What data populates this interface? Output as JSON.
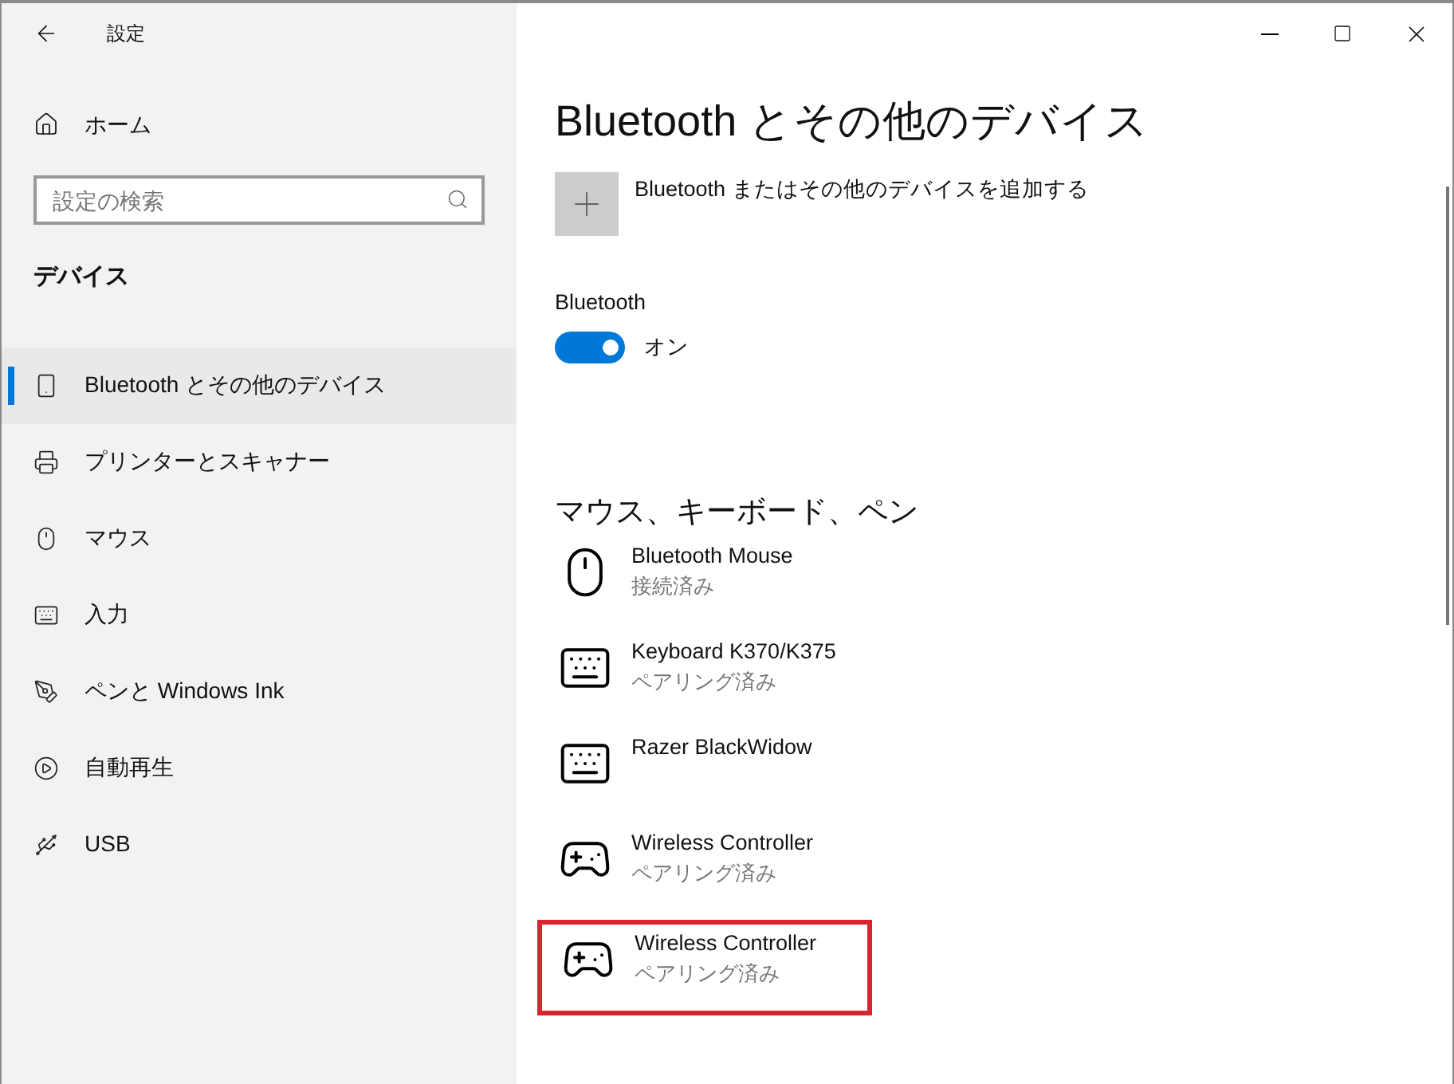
{
  "window": {
    "title": "設定"
  },
  "sidebar": {
    "home": "ホーム",
    "search": {
      "placeholder": "設定の検索"
    },
    "section": "デバイス",
    "items": [
      {
        "label": "Bluetooth とその他のデバイス",
        "kind": "bluetooth",
        "selected": true
      },
      {
        "label": "プリンターとスキャナー",
        "kind": "printer",
        "selected": false
      },
      {
        "label": "マウス",
        "kind": "mouse",
        "selected": false
      },
      {
        "label": "入力",
        "kind": "keyboard",
        "selected": false
      },
      {
        "label": "ペンと Windows Ink",
        "kind": "pen",
        "selected": false
      },
      {
        "label": "自動再生",
        "kind": "autoplay",
        "selected": false
      },
      {
        "label": "USB",
        "kind": "usb",
        "selected": false
      }
    ]
  },
  "main": {
    "heading": "Bluetooth とその他のデバイス",
    "add_device": "Bluetooth またはその他のデバイスを追加する",
    "bluetooth": {
      "label": "Bluetooth",
      "on": true,
      "state_text": "オン"
    },
    "section": "マウス、キーボード、ペン",
    "devices": [
      {
        "name": "Bluetooth Mouse",
        "status": "接続済み",
        "kind": "mouse",
        "highlighted": false
      },
      {
        "name": "Keyboard K370/K375",
        "status": "ペアリング済み",
        "kind": "keyboard",
        "highlighted": false
      },
      {
        "name": "Razer BlackWidow",
        "kind": "keyboard",
        "highlighted": false
      },
      {
        "name": "Wireless Controller",
        "status": "ペアリング済み",
        "kind": "gamepad",
        "highlighted": false
      },
      {
        "name": "Wireless Controller",
        "status": "ペアリング済み",
        "kind": "gamepad",
        "highlighted": true
      }
    ]
  }
}
